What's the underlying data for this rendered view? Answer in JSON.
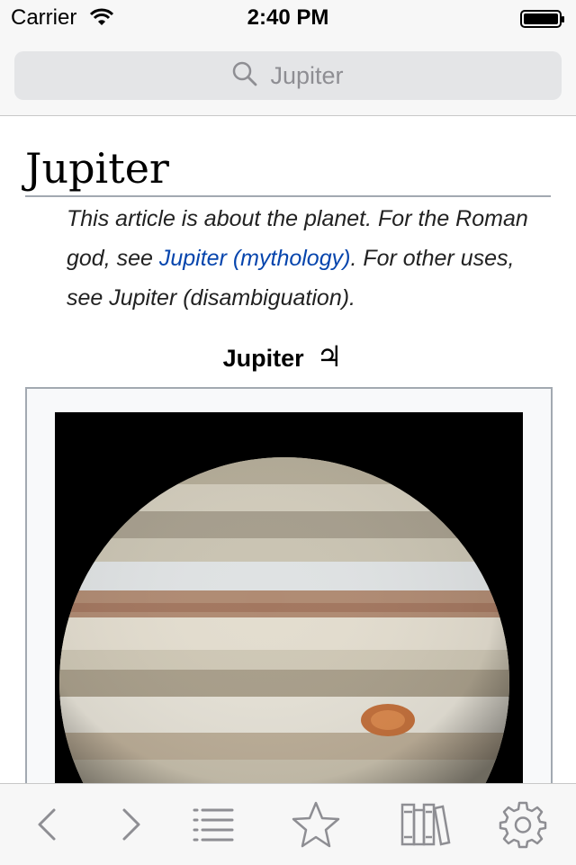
{
  "status_bar": {
    "carrier": "Carrier",
    "time": "2:40 PM"
  },
  "search": {
    "query": "Jupiter",
    "icon": "search-icon"
  },
  "article": {
    "title": "Jupiter",
    "hatnote": {
      "part1": "This article is about the planet. For the Roman god, see ",
      "link": "Jupiter (mythology)",
      "part2": ". For other uses, see Jupiter (disambiguation)."
    },
    "infobox": {
      "caption": "Jupiter",
      "symbol": "♃",
      "image": "jupiter-planet-photo"
    }
  },
  "toolbar": {
    "items": [
      "back-icon",
      "forward-icon",
      "table-of-contents-icon",
      "bookmark-star-icon",
      "library-icon",
      "settings-gear-icon"
    ]
  },
  "colors": {
    "link": "#0645ad",
    "icon_gray": "#8e8e93"
  }
}
